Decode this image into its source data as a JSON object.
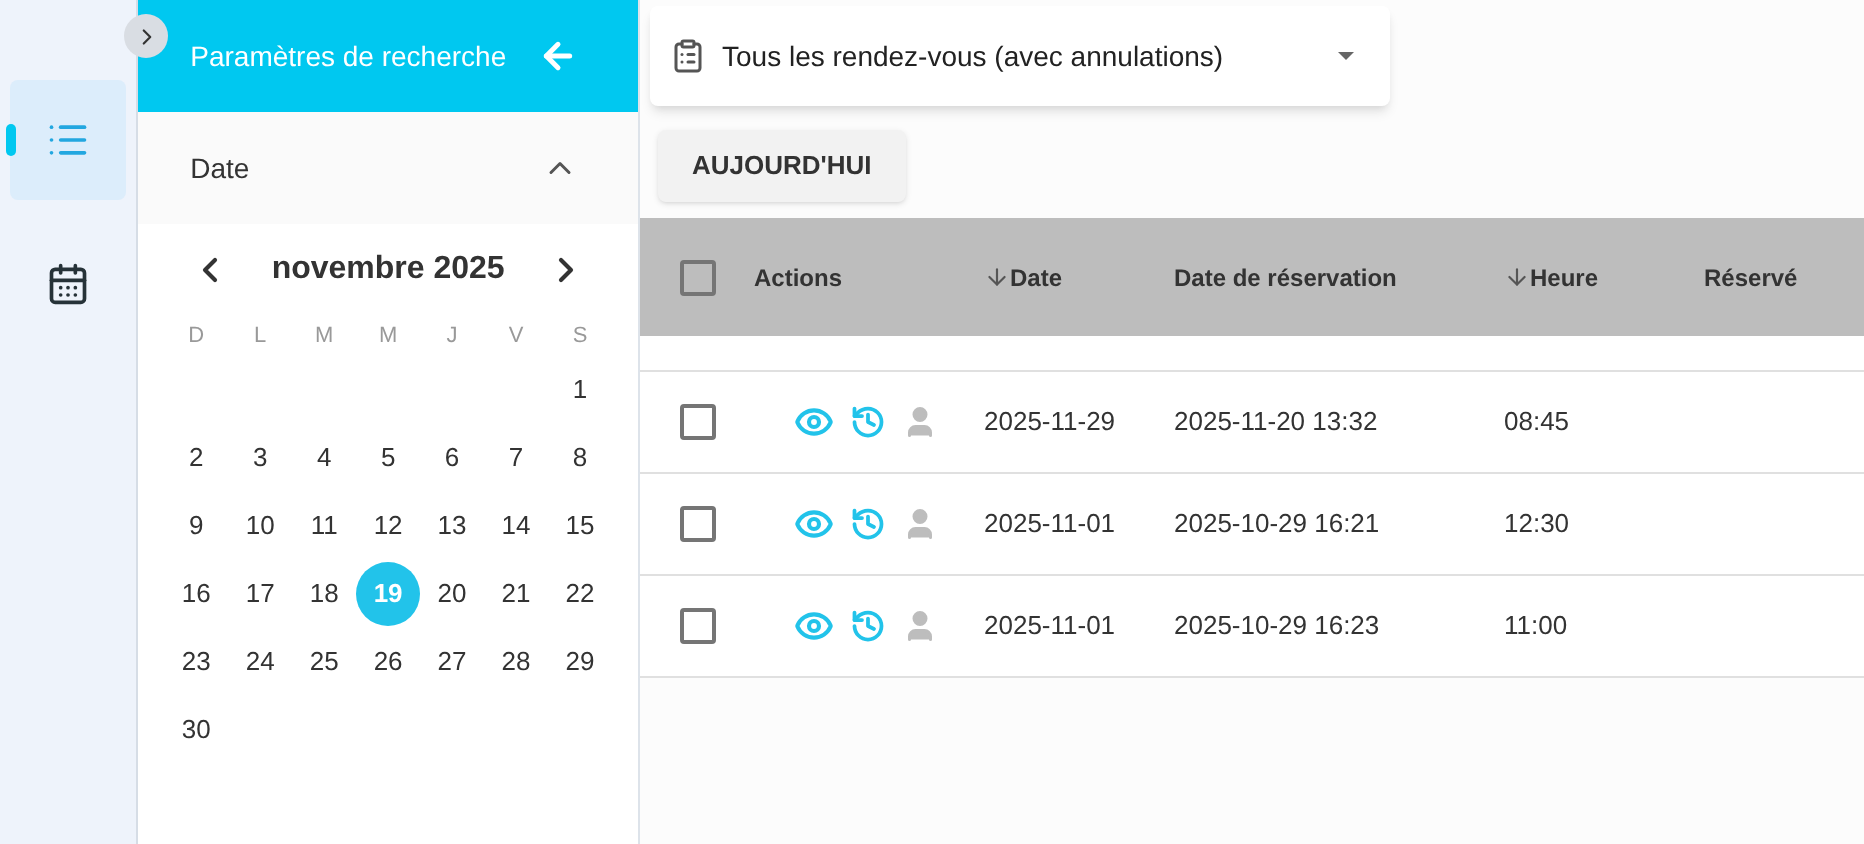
{
  "rail": {
    "items": [
      {
        "kind": "list",
        "selected": true
      },
      {
        "kind": "calendar",
        "selected": false
      }
    ]
  },
  "panel": {
    "title": "Paramètres de recherche",
    "section": {
      "label": "Date",
      "expanded": true
    },
    "calendar": {
      "month": "novembre 2025",
      "weekdays": [
        "D",
        "L",
        "M",
        "M",
        "J",
        "V",
        "S"
      ],
      "weeks": [
        [
          {
            "label": "1",
            "selected": false
          }
        ],
        [
          {
            "label": "2",
            "selected": false
          },
          {
            "label": "3",
            "selected": false
          },
          {
            "label": "4",
            "selected": false
          },
          {
            "label": "5",
            "selected": false
          },
          {
            "label": "6",
            "selected": false
          },
          {
            "label": "7",
            "selected": false
          },
          {
            "label": "8",
            "selected": false
          }
        ],
        [
          {
            "label": "9",
            "selected": false
          },
          {
            "label": "10",
            "selected": false
          },
          {
            "label": "11",
            "selected": false
          },
          {
            "label": "12",
            "selected": false
          },
          {
            "label": "13",
            "selected": false
          },
          {
            "label": "14",
            "selected": false
          },
          {
            "label": "15",
            "selected": false
          }
        ],
        [
          {
            "label": "16",
            "selected": false
          },
          {
            "label": "17",
            "selected": false
          },
          {
            "label": "18",
            "selected": false
          },
          {
            "label": "19",
            "selected": true
          },
          {
            "label": "20",
            "selected": false
          },
          {
            "label": "21",
            "selected": false
          },
          {
            "label": "22",
            "selected": false
          }
        ],
        [
          {
            "label": "23",
            "selected": false
          },
          {
            "label": "24",
            "selected": false
          },
          {
            "label": "25",
            "selected": false
          },
          {
            "label": "26",
            "selected": false
          },
          {
            "label": "27",
            "selected": false
          },
          {
            "label": "28",
            "selected": false
          },
          {
            "label": "29",
            "selected": false
          }
        ],
        [
          {
            "label": "30",
            "selected": false
          }
        ]
      ]
    }
  },
  "filter": {
    "value": "Tous les rendez-vous (avec annulations)"
  },
  "today_button": "AUJOURD'HUI",
  "table": {
    "select_all": {
      "checked": false
    },
    "columns": [
      {
        "label": "Actions",
        "sorted": false
      },
      {
        "label": "Date",
        "sorted": true
      },
      {
        "label": "Date de réservation",
        "sorted": false
      },
      {
        "label": "Heure",
        "sorted": true
      },
      {
        "label": "Réservé",
        "sorted": false
      }
    ],
    "rows": [
      {
        "checked": false,
        "date": "2025-11-29",
        "booked": "2025-11-20 13:32",
        "time": "08:45"
      },
      {
        "checked": false,
        "date": "2025-11-01",
        "booked": "2025-10-29 16:21",
        "time": "12:30"
      },
      {
        "checked": false,
        "date": "2025-11-01",
        "booked": "2025-10-29 16:23",
        "time": "11:00"
      }
    ]
  }
}
